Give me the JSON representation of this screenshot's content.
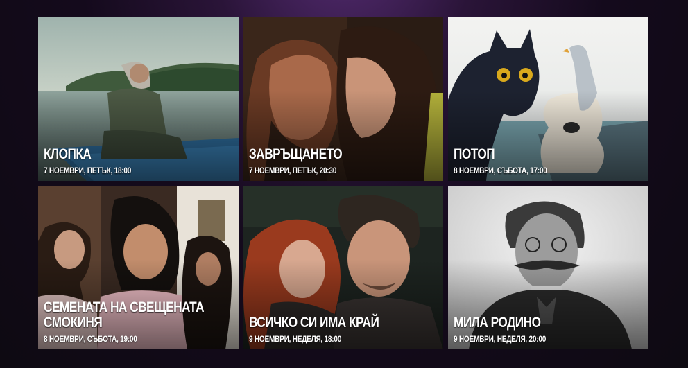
{
  "films": [
    {
      "title": "КЛОПКА",
      "date": "7 НОЕМВРИ, ПЕТЪК, 18:00"
    },
    {
      "title": "ЗАВРЪЩАНЕТО",
      "date": "7 НОЕМВРИ, ПЕТЪК, 20:30"
    },
    {
      "title": "ПОТОП",
      "date": "8 НОЕМВРИ, СЪБОТА, 17:00"
    },
    {
      "title": "СЕМЕНАТА НА СВЕЩЕНАТА СМОКИНЯ",
      "date": "8 НОЕМВРИ, СЪБОТА, 19:00"
    },
    {
      "title": "ВСИЧКО СИ ИМА КРАЙ",
      "date": "9 НОЕМВРИ, НЕДЕЛЯ, 18:00"
    },
    {
      "title": "МИЛА РОДИНО",
      "date": "9 НОЕМВРИ, НЕДЕЛЯ, 20:00"
    }
  ]
}
